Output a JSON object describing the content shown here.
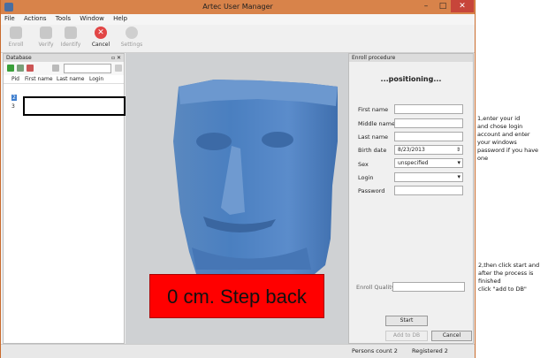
{
  "window": {
    "title": "Artec User Manager"
  },
  "menu": [
    "File",
    "Actions",
    "Tools",
    "Window",
    "Help"
  ],
  "toolbar": {
    "enroll": "Enroll",
    "verify": "Verify",
    "identify": "Identify",
    "cancel": "Cancel",
    "settings": "Settings"
  },
  "database": {
    "title": "Database",
    "columns": [
      "Pid",
      "First name",
      "Last name",
      "Login"
    ],
    "rows": [
      "2",
      "3"
    ]
  },
  "viewport": {
    "message": "0 cm. Step back"
  },
  "enroll": {
    "title": "Enroll procedure",
    "status": "...positioning...",
    "labels": {
      "first_name": "First name",
      "middle_name": "Middle name",
      "last_name": "Last name",
      "birth_date": "Birth date",
      "sex": "Sex",
      "login": "Login",
      "password": "Password",
      "quality": "Enroll Quality"
    },
    "values": {
      "birth_date": "8/23/2013",
      "sex": "unspecified"
    },
    "buttons": {
      "start": "Start",
      "add": "Add to DB",
      "cancel": "Cancel"
    }
  },
  "statusbar": {
    "persons": "Persons count 2",
    "registered": "Registered 2"
  },
  "notes": {
    "n1": [
      "1,enter your id",
      "and chose login",
      "account and enter",
      "your windows",
      "password if you have",
      "one"
    ],
    "n2": [
      "2,then click start and",
      "after the process is",
      "finished",
      "click \"add to DB\""
    ]
  }
}
